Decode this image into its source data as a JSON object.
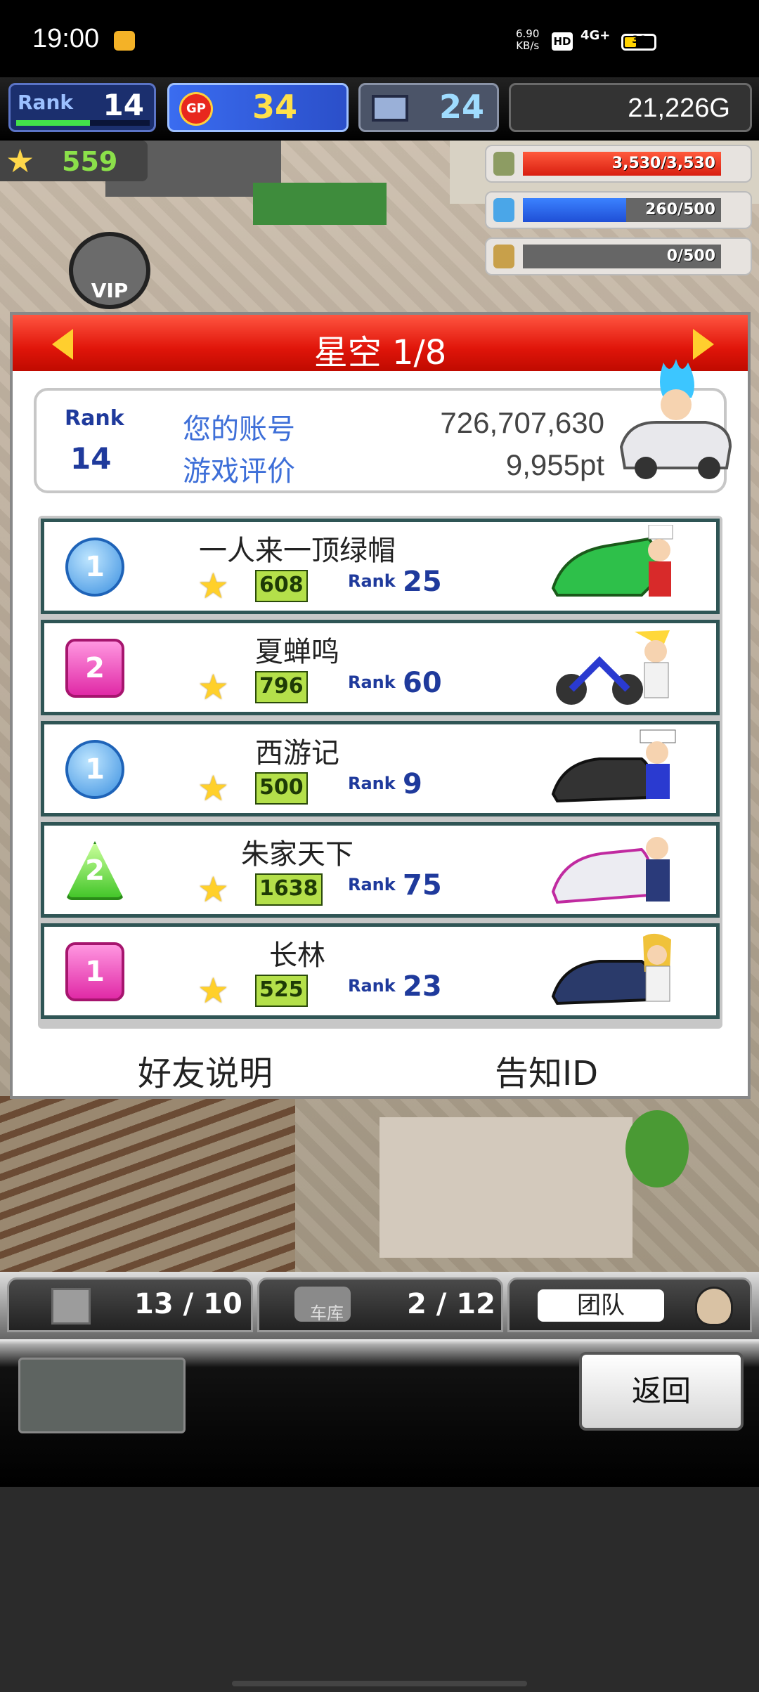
{
  "status_bar": {
    "time": "19:00",
    "speed_value": "6.90",
    "speed_unit": "KB/s",
    "hd": "HD",
    "network": "4G+",
    "battery": "36"
  },
  "hud": {
    "rank_label": "Rank",
    "rank_value": "14",
    "rank_progress": 0.55,
    "gp_value": "34",
    "gp_icon_text": "GP",
    "pc_value": "24",
    "money": "21,226G",
    "fans": "559"
  },
  "resources": {
    "gas": {
      "text": "3,530/3,530",
      "fraction": 1.0
    },
    "oil": {
      "text": "260/500",
      "fraction": 0.52
    },
    "wheat": {
      "text": "0/500",
      "fraction": 0.0
    }
  },
  "vip_label": "VIP",
  "dialog": {
    "title": "星空 1/8",
    "me": {
      "rank_label": "Rank",
      "rank_value": "14",
      "account_label": "您的账号",
      "account_value": "726,707,630",
      "rating_label": "游戏评价",
      "rating_value": "9,955pt"
    },
    "friends": [
      {
        "name": "一人来一顶绿帽",
        "fans": "608",
        "rank_label": "Rank",
        "rank": "25",
        "badge": "1"
      },
      {
        "name": "夏蝉鸣",
        "fans": "796",
        "rank_label": "Rank",
        "rank": "60",
        "badge": "2"
      },
      {
        "name": "西游记",
        "fans": "500",
        "rank_label": "Rank",
        "rank": "9",
        "badge": "1"
      },
      {
        "name": "朱家天下",
        "fans": "1638",
        "rank_label": "Rank",
        "rank": "75",
        "badge": "2"
      },
      {
        "name": "长林",
        "fans": "525",
        "rank_label": "Rank",
        "rank": "23",
        "badge": "1"
      }
    ],
    "footer": {
      "friend_help": "好友说明",
      "tell_id": "告知ID"
    }
  },
  "bottom_tabs": {
    "storage": "13 / 10",
    "garage": "2 / 12",
    "garage_caption": "车库",
    "team": "团队"
  },
  "return_button": "返回",
  "colors": {
    "header_red": "#e0150a",
    "link_blue": "#3e6fd8",
    "badge_blue": "#3a8fe0",
    "badge_pink": "#e02aa6",
    "badge_green": "#44c62a",
    "fans_green": "#b4e04a"
  }
}
